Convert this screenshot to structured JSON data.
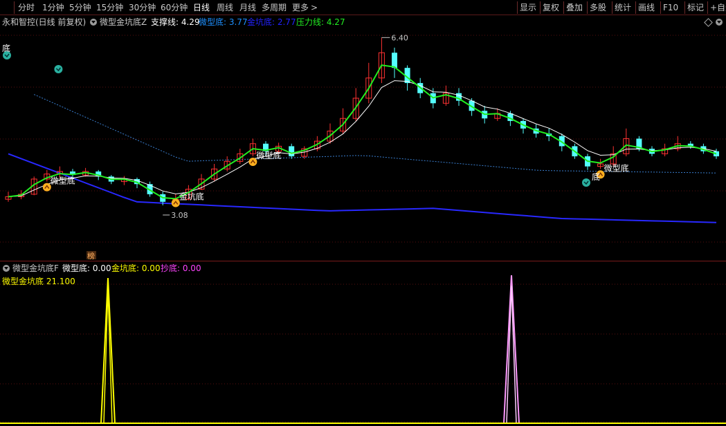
{
  "toolbar": {
    "periods": [
      "分时",
      "1分钟",
      "5分钟",
      "15分钟",
      "30分钟",
      "60分钟",
      "日线",
      "周线",
      "月线",
      "多周期",
      "更多"
    ],
    "active_period": "日线",
    "more_arrow": ">",
    "right_buttons": [
      "显示",
      "复权",
      "叠加",
      "多股",
      "统计",
      "画线",
      "F10",
      "标记",
      "+自选"
    ]
  },
  "infobar": {
    "stock_title": "永和智控(日线 前复权)",
    "indicator_name": "微型金坑底Z",
    "support_label": "支撑线: 4.29",
    "micro_label": "微型底: 3.77",
    "gold_label": "金坑底: 2.77",
    "pressure_label": "压力线: 4.27",
    "colors": {
      "support": "#ffffff",
      "micro": "#1e90ff",
      "gold": "#2222ff",
      "pressure": "#22ee22"
    }
  },
  "main_annotations": {
    "high_price": "6.40",
    "low_price": "3.08",
    "signals": [
      {
        "text": "微型底",
        "kind": "micro"
      },
      {
        "text": "微型底",
        "kind": "micro"
      },
      {
        "text": "金坑底",
        "kind": "gold"
      },
      {
        "text": "微型底",
        "kind": "micro"
      }
    ],
    "partial_label_left": "底",
    "partial_label_right": "底",
    "bang_badge": "榜"
  },
  "subinfo": {
    "indicator_name": "微型金坑底F",
    "micro_label": "微型底: 0.00",
    "gold_label": "金坑底: 0.00",
    "chaodi_label": "抄底: 0.00",
    "value_label": "微型金坑底 21.100",
    "colors": {
      "micro": "#ffffff",
      "gold": "#ffff00",
      "chaodi": "#ff44ff",
      "value": "#ffff00"
    }
  },
  "chart_data": {
    "type": "candlestick",
    "candles": [
      [
        3.2,
        3.25,
        3.35,
        3.15
      ],
      [
        3.25,
        3.3,
        3.38,
        3.2
      ],
      [
        3.3,
        3.6,
        3.65,
        3.28
      ],
      [
        3.6,
        3.7,
        3.78,
        3.55
      ],
      [
        3.7,
        3.75,
        3.85,
        3.62
      ],
      [
        3.75,
        3.68,
        3.8,
        3.6
      ],
      [
        3.68,
        3.75,
        3.82,
        3.65
      ],
      [
        3.75,
        3.65,
        3.78,
        3.58
      ],
      [
        3.65,
        3.55,
        3.68,
        3.5
      ],
      [
        3.55,
        3.6,
        3.66,
        3.48
      ],
      [
        3.6,
        3.5,
        3.63,
        3.42
      ],
      [
        3.5,
        3.3,
        3.55,
        3.25
      ],
      [
        3.3,
        3.15,
        3.35,
        3.08
      ],
      [
        3.15,
        3.2,
        3.3,
        3.1
      ],
      [
        3.2,
        3.4,
        3.48,
        3.18
      ],
      [
        3.4,
        3.6,
        3.7,
        3.38
      ],
      [
        3.6,
        3.8,
        3.9,
        3.55
      ],
      [
        3.8,
        3.95,
        4.05,
        3.75
      ],
      [
        3.95,
        4.1,
        4.2,
        3.9
      ],
      [
        4.1,
        4.3,
        4.4,
        4.05
      ],
      [
        4.3,
        4.15,
        4.35,
        4.05
      ],
      [
        4.15,
        4.25,
        4.32,
        4.1
      ],
      [
        4.25,
        4.05,
        4.3,
        4.0
      ],
      [
        4.05,
        4.2,
        4.25,
        4.0
      ],
      [
        4.2,
        4.35,
        4.45,
        4.15
      ],
      [
        4.35,
        4.55,
        4.7,
        4.3
      ],
      [
        4.55,
        4.8,
        5.0,
        4.5
      ],
      [
        4.8,
        5.2,
        5.4,
        4.75
      ],
      [
        5.2,
        5.6,
        5.9,
        5.1
      ],
      [
        5.6,
        6.1,
        6.4,
        5.5
      ],
      [
        6.1,
        5.8,
        6.2,
        5.6
      ],
      [
        5.8,
        5.5,
        5.85,
        5.35
      ],
      [
        5.5,
        5.3,
        5.6,
        5.2
      ],
      [
        5.3,
        5.1,
        5.4,
        5.0
      ],
      [
        5.1,
        5.3,
        5.45,
        5.05
      ],
      [
        5.3,
        5.15,
        5.4,
        5.05
      ],
      [
        5.15,
        4.95,
        5.2,
        4.85
      ],
      [
        4.95,
        4.8,
        5.05,
        4.7
      ],
      [
        4.8,
        4.9,
        5.0,
        4.75
      ],
      [
        4.9,
        4.75,
        4.95,
        4.65
      ],
      [
        4.75,
        4.6,
        4.8,
        4.5
      ],
      [
        4.6,
        4.5,
        4.68,
        4.42
      ],
      [
        4.5,
        4.45,
        4.6,
        4.35
      ],
      [
        4.45,
        4.25,
        4.5,
        4.15
      ],
      [
        4.25,
        4.05,
        4.3,
        4.0
      ],
      [
        4.05,
        3.85,
        4.1,
        3.78
      ],
      [
        3.85,
        3.9,
        4.0,
        3.8
      ],
      [
        3.9,
        4.1,
        4.25,
        3.85
      ],
      [
        4.1,
        4.4,
        4.6,
        4.05
      ],
      [
        4.4,
        4.2,
        4.45,
        4.15
      ],
      [
        4.2,
        4.1,
        4.25,
        4.05
      ],
      [
        4.1,
        4.2,
        4.3,
        4.05
      ],
      [
        4.2,
        4.3,
        4.45,
        4.15
      ],
      [
        4.3,
        4.25,
        4.35,
        4.2
      ],
      [
        4.25,
        4.15,
        4.3,
        4.1
      ],
      [
        4.15,
        4.05,
        4.2,
        4.0
      ]
    ],
    "y_high": "6.40",
    "y_low": "3.08"
  }
}
